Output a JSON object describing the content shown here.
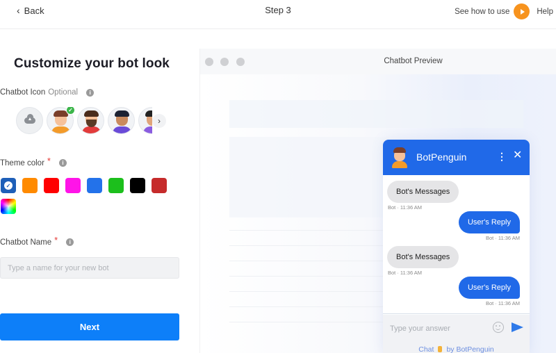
{
  "topbar": {
    "back_label": "Back",
    "step_label": "Step 3",
    "see_how_label": "See how to use",
    "help_label": "Help",
    "accent_color": "#f7931e"
  },
  "form": {
    "title": "Customize your bot look",
    "chatbot_icon": {
      "label": "Chatbot Icon",
      "optional_label": "Optional",
      "icons": [
        {
          "name": "upload-icon",
          "selected": false
        },
        {
          "name": "avatar-boy-orange",
          "selected": true
        },
        {
          "name": "avatar-bearded-man",
          "selected": false
        },
        {
          "name": "avatar-curly-man",
          "selected": false
        },
        {
          "name": "avatar-purple-partial",
          "selected": false
        }
      ]
    },
    "theme_color": {
      "label": "Theme color",
      "required_mark": "*",
      "swatches": [
        {
          "color": "#1e5fb8",
          "selected": true
        },
        {
          "color": "#ff8a00",
          "selected": false
        },
        {
          "color": "#ff0000",
          "selected": false
        },
        {
          "color": "#ff14e8",
          "selected": false
        },
        {
          "color": "#2372ea",
          "selected": false
        },
        {
          "color": "#1cbf1c",
          "selected": false
        },
        {
          "color": "#000000",
          "selected": false
        },
        {
          "color": "#c62b2b",
          "selected": false
        },
        {
          "color": "custom-gradient",
          "selected": false
        }
      ]
    },
    "chatbot_name": {
      "label": "Chatbot Name",
      "required_mark": "*",
      "value": "",
      "placeholder": "Type a name for your new bot"
    },
    "next_label": "Next",
    "primary_color": "#0d7ff9"
  },
  "preview": {
    "title": "Chatbot Preview",
    "chat": {
      "bot_name": "BotPenguin",
      "header_color": "#2069e8",
      "messages": [
        {
          "from": "bot",
          "text": "Bot's Messages",
          "meta": "Bot · 11:36 AM"
        },
        {
          "from": "user",
          "text": "User's Reply",
          "meta": "Bot · 11:36 AM"
        },
        {
          "from": "bot",
          "text": "Bot's Messages",
          "meta": "Bot · 11:36 AM"
        },
        {
          "from": "user",
          "text": "User's Reply",
          "meta": "Bot · 11:36 AM"
        }
      ],
      "input_placeholder": "Type your answer",
      "branding_prefix": "Chat",
      "branding_suffix": "by BotPenguin"
    }
  }
}
